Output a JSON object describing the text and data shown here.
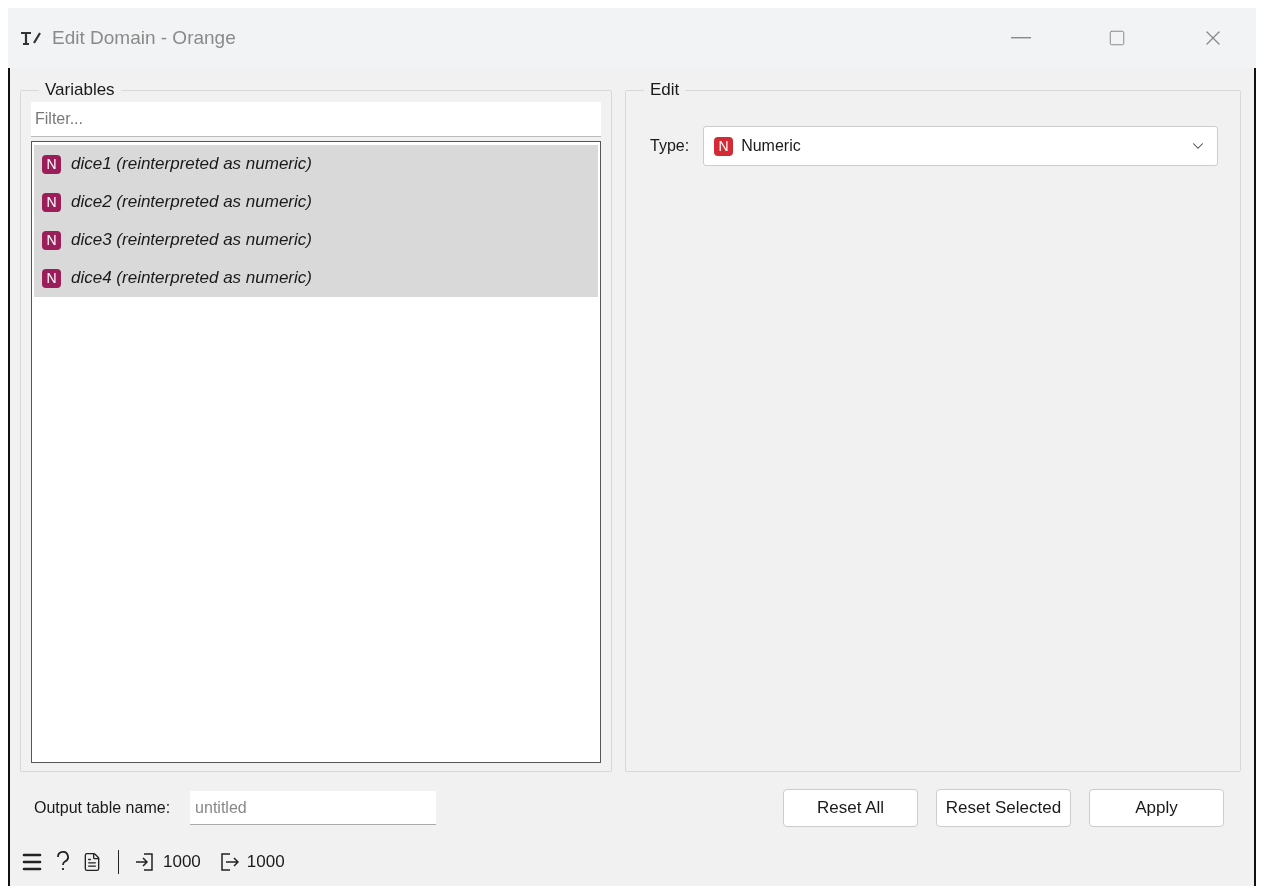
{
  "window": {
    "title": "Edit Domain - Orange"
  },
  "variables": {
    "title": "Variables",
    "filter": {
      "placeholder": "Filter..."
    },
    "items": [
      {
        "badge": "N",
        "name": "dice1 (reinterpreted as numeric)",
        "selected": true
      },
      {
        "badge": "N",
        "name": "dice2 (reinterpreted as numeric)",
        "selected": true
      },
      {
        "badge": "N",
        "name": "dice3 (reinterpreted as numeric)",
        "selected": true
      },
      {
        "badge": "N",
        "name": "dice4 (reinterpreted as numeric)",
        "selected": true
      }
    ]
  },
  "edit": {
    "title": "Edit",
    "type_label": "Type:",
    "type_value": {
      "badge": "N",
      "label": "Numeric"
    }
  },
  "output": {
    "label": "Output table name:",
    "placeholder": "untitled"
  },
  "buttons": [
    "Reset All",
    "Reset Selected",
    "Apply"
  ],
  "status_bar": {
    "input_count": "1000",
    "output_count": "1000"
  }
}
